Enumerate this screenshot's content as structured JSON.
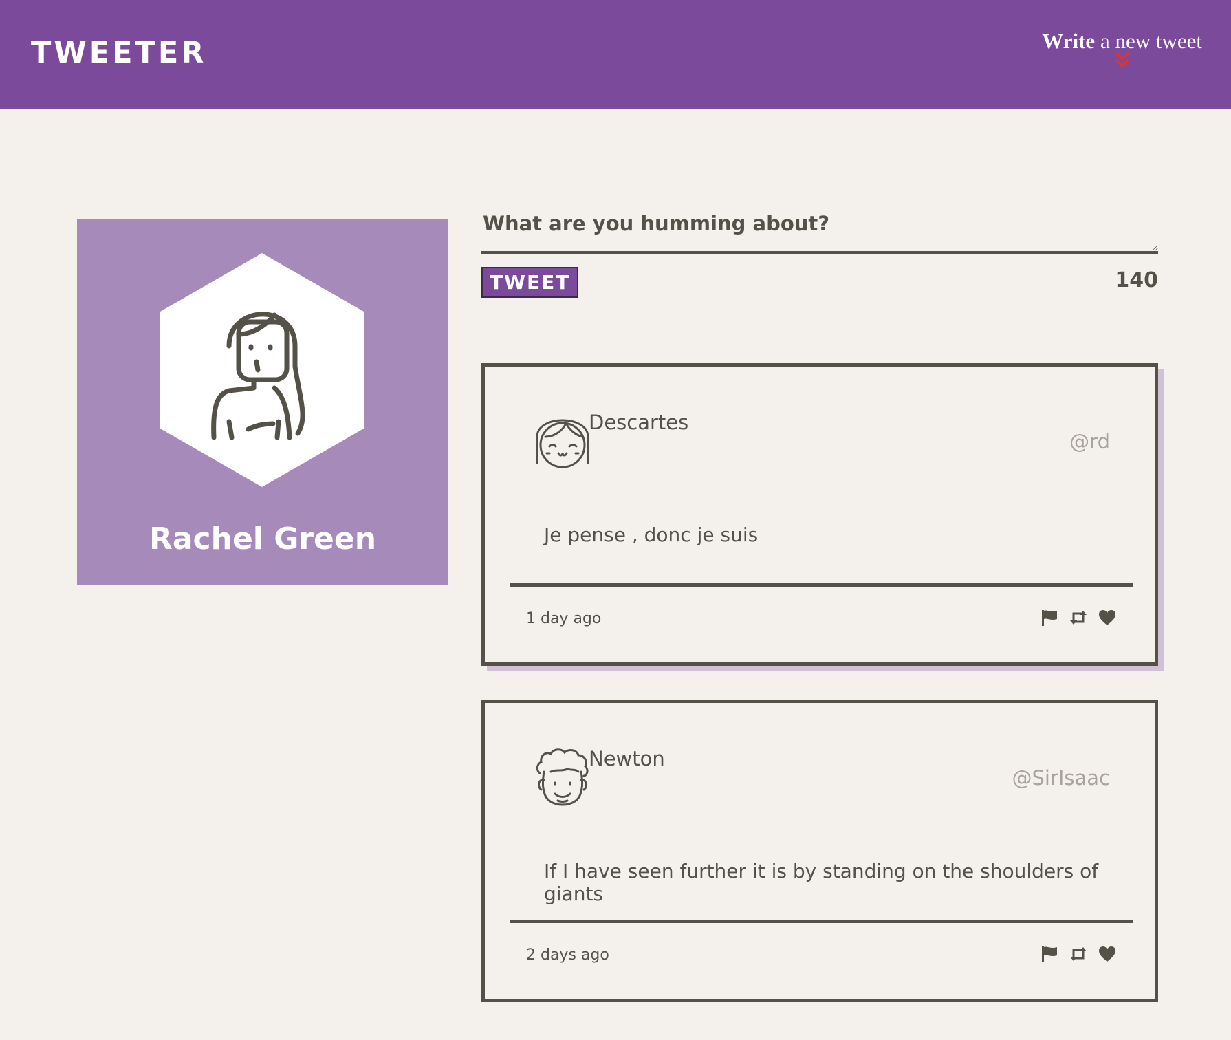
{
  "nav": {
    "brand": "TWEETER",
    "compose_link": {
      "bold": "Write",
      "rest": " a new tweet",
      "icon": "double-chevron-down-icon"
    }
  },
  "profile": {
    "name": "Rachel Green",
    "avatar_icon": "woman-avatar-icon"
  },
  "composer": {
    "placeholder": "What are you humming about?",
    "value": "",
    "button_label": "TWEET",
    "char_count": "140"
  },
  "tweets": [
    {
      "author": "Descartes",
      "handle": "@rd",
      "text": "Je pense , donc je suis",
      "time": "1 day ago",
      "avatar_icon": "girl-avatar-icon"
    },
    {
      "author": "Newton",
      "handle": "@SirIsaac",
      "text": "If I have seen further it is by standing on the shoulders of giants",
      "time": "2 days ago",
      "avatar_icon": "curly-hair-avatar-icon"
    }
  ],
  "colors": {
    "brand_purple": "#7b4a9b",
    "card_purple": "#a68ab9",
    "ink": "#545149",
    "background": "#f4f1ec",
    "arrow_red": "#e0342a",
    "handle_gray": "#a8a49c"
  }
}
